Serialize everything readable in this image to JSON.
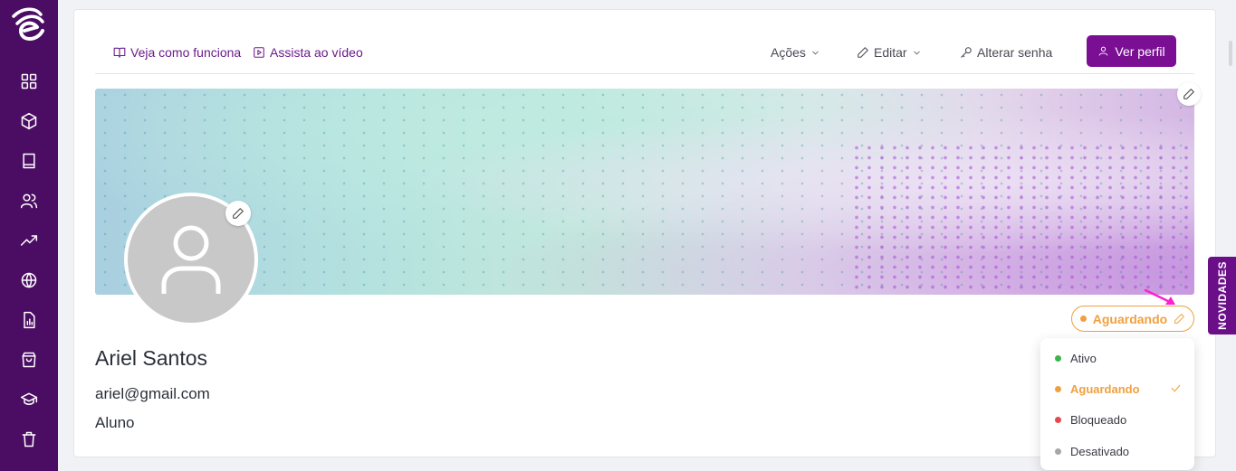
{
  "sidebar": {
    "logo": "brand-logo",
    "items": [
      {
        "icon": "dashboard-grid-icon"
      },
      {
        "icon": "box-icon"
      },
      {
        "icon": "book-icon"
      },
      {
        "icon": "users-icon"
      },
      {
        "icon": "trending-up-icon"
      },
      {
        "icon": "globe-icon"
      },
      {
        "icon": "report-icon"
      },
      {
        "icon": "shopping-bag-icon"
      },
      {
        "icon": "graduation-cap-icon"
      },
      {
        "icon": "trash-icon"
      }
    ]
  },
  "toolbar": {
    "how_it_works": "Veja como funciona",
    "watch_video": "Assista ao vídeo",
    "actions": "Ações",
    "edit": "Editar",
    "change_password": "Alterar senha",
    "view_profile": "Ver perfil"
  },
  "profile": {
    "name": "Ariel Santos",
    "email": "ariel@gmail.com",
    "role": "Aluno"
  },
  "status": {
    "current": "Aguardando",
    "color": "#f0a040",
    "options": [
      {
        "label": "Ativo",
        "color": "#3cb54a"
      },
      {
        "label": "Aguardando",
        "color": "#f0a040"
      },
      {
        "label": "Bloqueado",
        "color": "#e5484d"
      },
      {
        "label": "Desativado",
        "color": "#a6a6a6"
      }
    ]
  },
  "side_tab": "NOVIDADES",
  "colors": {
    "sidebar": "#4b0d63",
    "accent": "#7a0f94",
    "arrow": "#ff1fd0"
  }
}
